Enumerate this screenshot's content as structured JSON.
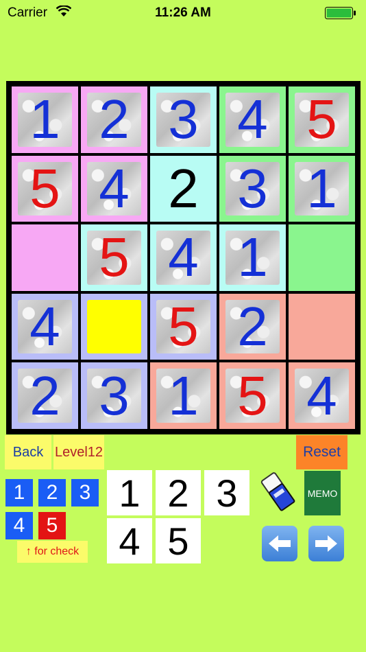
{
  "status_bar": {
    "carrier": "Carrier",
    "time": "11:26 AM"
  },
  "board": {
    "rows": [
      [
        {
          "value": "1",
          "color": "blue",
          "bg": "#f7a8f4",
          "tile": true
        },
        {
          "value": "2",
          "color": "blue",
          "bg": "#f7a8f4",
          "tile": true
        },
        {
          "value": "3",
          "color": "blue",
          "bg": "#b8fcf4",
          "tile": true
        },
        {
          "value": "4",
          "color": "blue",
          "bg": "#8af58e",
          "tile": true
        },
        {
          "value": "5",
          "color": "red",
          "bg": "#8af58e",
          "tile": true
        }
      ],
      [
        {
          "value": "5",
          "color": "red",
          "bg": "#f7a8f4",
          "tile": true
        },
        {
          "value": "4",
          "color": "blue",
          "bg": "#f7a8f4",
          "tile": true
        },
        {
          "value": "2",
          "color": "black",
          "bg": "#b8fcf4",
          "tile": false
        },
        {
          "value": "3",
          "color": "blue",
          "bg": "#8af58e",
          "tile": true
        },
        {
          "value": "1",
          "color": "blue",
          "bg": "#8af58e",
          "tile": true
        }
      ],
      [
        {
          "value": "",
          "color": "blue",
          "bg": "#f7a8f4",
          "tile": false
        },
        {
          "value": "5",
          "color": "red",
          "bg": "#b8fcf4",
          "tile": true
        },
        {
          "value": "4",
          "color": "blue",
          "bg": "#b8fcf4",
          "tile": true
        },
        {
          "value": "1",
          "color": "blue",
          "bg": "#b8fcf4",
          "tile": true
        },
        {
          "value": "",
          "color": "blue",
          "bg": "#8af58e",
          "tile": false
        }
      ],
      [
        {
          "value": "4",
          "color": "blue",
          "bg": "#b9bdf8",
          "tile": true
        },
        {
          "value": "",
          "color": "blue",
          "bg": "#b9bdf8",
          "tile": false,
          "selected": true
        },
        {
          "value": "5",
          "color": "red",
          "bg": "#b9bdf8",
          "tile": true
        },
        {
          "value": "2",
          "color": "blue",
          "bg": "#f8a89a",
          "tile": true
        },
        {
          "value": "",
          "color": "blue",
          "bg": "#f8a89a",
          "tile": false
        }
      ],
      [
        {
          "value": "2",
          "color": "blue",
          "bg": "#b9bdf8",
          "tile": true
        },
        {
          "value": "3",
          "color": "blue",
          "bg": "#b9bdf8",
          "tile": true
        },
        {
          "value": "1",
          "color": "blue",
          "bg": "#f8a89a",
          "tile": true
        },
        {
          "value": "5",
          "color": "red",
          "bg": "#f8a89a",
          "tile": true
        },
        {
          "value": "4",
          "color": "blue",
          "bg": "#f8a89a",
          "tile": true
        }
      ]
    ],
    "selected_color": "#ffff00"
  },
  "controls": {
    "back_label": "Back",
    "level_label": "Level12",
    "reset_label": "Reset",
    "check_label": "↑ for check",
    "memo_label": "MEMO",
    "check_keys": [
      {
        "label": "1",
        "color": "#1a5df5"
      },
      {
        "label": "2",
        "color": "#1a5df5"
      },
      {
        "label": "3",
        "color": "#1a5df5"
      },
      {
        "label": "4",
        "color": "#1a5df5"
      },
      {
        "label": "5",
        "color": "#e31414"
      }
    ],
    "number_keys": [
      "1",
      "2",
      "3",
      "4",
      "5"
    ],
    "icons": {
      "eraser": "eraser-icon",
      "left": "left-arrow-icon",
      "right": "right-arrow-icon",
      "wifi": "wifi-icon",
      "battery": "battery-icon"
    }
  }
}
